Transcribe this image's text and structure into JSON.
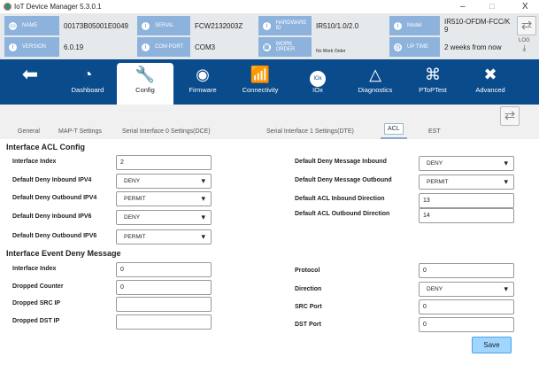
{
  "window": {
    "title": "IoT Device Manager 5.3.0.1",
    "minimize": "–",
    "maximize": "□",
    "close": "X"
  },
  "info": [
    {
      "label": "NAME",
      "value": "00173B05001E0049"
    },
    {
      "label": "SERIAL",
      "value": "FCW2132003Z"
    },
    {
      "label": "HARDWARE ID",
      "value": "IR510/1.0/2.0"
    },
    {
      "label": "Model",
      "value": "IR510-OFDM-FCC/K 9"
    },
    {
      "label": "VERSION",
      "value": "6.0.19"
    },
    {
      "label": "COM PORT",
      "value": "COM3"
    },
    {
      "label": "WORK ORDER",
      "value": "No Work Order"
    },
    {
      "label": "UP TIME",
      "value": "2 weeks from now"
    }
  ],
  "log_label": "LOG",
  "nav": [
    {
      "label": "Dashboard",
      "icon": "◔"
    },
    {
      "label": "Config",
      "icon": "🔧"
    },
    {
      "label": "Firmware",
      "icon": "◉"
    },
    {
      "label": "Connectivity",
      "icon": "📶"
    },
    {
      "label": "IOx",
      "icon": "●"
    },
    {
      "label": "Diagnostics",
      "icon": "△"
    },
    {
      "label": "PToPTest",
      "icon": "⌘"
    },
    {
      "label": "Advanced",
      "icon": "✖"
    }
  ],
  "iox_text": "IOx",
  "tabs": [
    "General",
    "MAP-T Settings",
    "Serial Interface 0 Settings(DCE)",
    "Serial Interface 1 Settings(DTE)",
    "ACL",
    "EST"
  ],
  "acl": {
    "title": "Interface ACL Config",
    "left": [
      {
        "label": "Interface Index",
        "value": "2"
      },
      {
        "label": "Default Deny Inbound IPV4",
        "value": "DENY"
      },
      {
        "label": "Default Deny Outbound IPV4",
        "value": "PERMIT"
      },
      {
        "label": "Default Deny Inbound IPV6",
        "value": "DENY"
      },
      {
        "label": "Default Deny Outbound IPV6",
        "value": "PERMIT"
      }
    ],
    "right": [
      {
        "label": "Default Deny Message Inbound",
        "value": "DENY"
      },
      {
        "label": "Default Deny Message Outbound",
        "value": "PERMIT"
      },
      {
        "label": "Default ACL Inbound Direction",
        "value": "13"
      },
      {
        "label": "Default ACL Outbound Direction",
        "value": "14"
      }
    ]
  },
  "deny": {
    "title": "Interface Event Deny Message",
    "left": [
      {
        "label": "Interface Index",
        "value": "0"
      },
      {
        "label": "Dropped Counter",
        "value": "0"
      },
      {
        "label": "Dropped SRC IP",
        "value": ""
      },
      {
        "label": "Dropped DST IP",
        "value": ""
      }
    ],
    "right": [
      {
        "label": "Protocol",
        "value": "0"
      },
      {
        "label": "Direction",
        "value": "DENY"
      },
      {
        "label": "SRC Port",
        "value": "0"
      },
      {
        "label": "DST Port",
        "value": "0"
      }
    ]
  },
  "save_label": "Save"
}
